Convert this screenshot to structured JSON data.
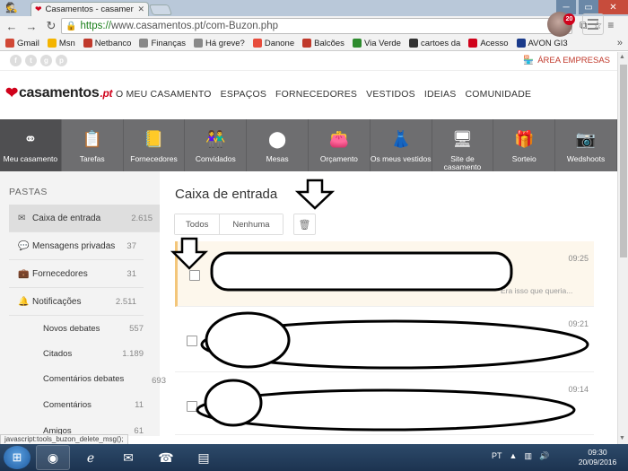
{
  "browser": {
    "tab_title": "Casamentos - casamentos",
    "url_scheme": "https://",
    "url_rest": "www.casamentos.pt/com-Buzon.php",
    "bookmarks": [
      {
        "label": "Gmail",
        "color": "#d14836"
      },
      {
        "label": "Msn",
        "color": "#f4b400"
      },
      {
        "label": "Netbanco",
        "color": "#c0392b"
      },
      {
        "label": "Finanças",
        "color": "#888888"
      },
      {
        "label": "Há greve?",
        "color": "#888888"
      },
      {
        "label": "Danone",
        "color": "#e74c3c"
      },
      {
        "label": "Balcões",
        "color": "#c0392b"
      },
      {
        "label": "Via Verde",
        "color": "#2e8b2e"
      },
      {
        "label": "cartoes da",
        "color": "#333333"
      },
      {
        "label": "Acesso",
        "color": "#d0021b"
      },
      {
        "label": "AVON GI3",
        "color": "#1a3a8a"
      }
    ]
  },
  "site": {
    "area_empresas": "ÁREA EMPRESAS",
    "logo_main": "casamentos",
    "logo_suffix": ".pt",
    "nav": [
      "O MEU CASAMENTO",
      "ESPAÇOS",
      "FORNECEDORES",
      "VESTIDOS",
      "IDEIAS",
      "COMUNIDADE"
    ],
    "avatar_badge": "20",
    "tools": [
      {
        "label": "Meu casamento",
        "icon": "rings-icon",
        "glyph": "⚭",
        "active": true
      },
      {
        "label": "Tarefas",
        "icon": "clipboard-icon",
        "glyph": "📋",
        "active": false
      },
      {
        "label": "Fornecedores",
        "icon": "notebook-icon",
        "glyph": "📒",
        "active": false
      },
      {
        "label": "Convidados",
        "icon": "guests-icon",
        "glyph": "👫",
        "active": false
      },
      {
        "label": "Mesas",
        "icon": "table-icon",
        "glyph": "⬤",
        "active": false
      },
      {
        "label": "Orçamento",
        "icon": "wallet-icon",
        "glyph": "👛",
        "active": false
      },
      {
        "label": "Os meus vestidos",
        "icon": "dress-icon",
        "glyph": "👗",
        "active": false
      },
      {
        "label": "Site de casamento",
        "icon": "website-icon",
        "glyph": "🖥",
        "active": false
      },
      {
        "label": "Sorteio",
        "icon": "gift-icon",
        "glyph": "🎁",
        "active": false
      },
      {
        "label": "Wedshoots",
        "icon": "camera-icon",
        "glyph": "📷",
        "active": false
      }
    ]
  },
  "sidebar": {
    "title": "PASTAS",
    "folders": [
      {
        "label": "Caixa de entrada",
        "count": "2.615",
        "icon": "inbox-icon",
        "glyph": "✉",
        "active": true
      },
      {
        "label": "Mensagens privadas",
        "count": "37",
        "icon": "chat-icon",
        "glyph": "💬",
        "active": false
      },
      {
        "label": "Fornecedores",
        "count": "31",
        "icon": "briefcase-icon",
        "glyph": "💼",
        "active": false
      },
      {
        "label": "Notificações",
        "count": "2.511",
        "icon": "bell-icon",
        "glyph": "🔔",
        "active": false
      }
    ],
    "subfolders": [
      {
        "label": "Novos debates",
        "count": "557"
      },
      {
        "label": "Citados",
        "count": "1.189"
      },
      {
        "label": "Comentários debates",
        "count": "693"
      },
      {
        "label": "Comentários",
        "count": "11"
      },
      {
        "label": "Amigos",
        "count": "61"
      }
    ]
  },
  "inbox": {
    "title": "Caixa de entrada",
    "btn_all": "Todos",
    "btn_none": "Nenhuma",
    "messages": [
      {
        "time": "09:25",
        "snippet": "Era isso que queria...",
        "unread": true
      },
      {
        "time": "09:21",
        "snippet": "",
        "unread": false
      },
      {
        "time": "09:14",
        "snippet": "",
        "unread": false
      }
    ]
  },
  "status_link": "javascript:tools_buzon_delete_msg();",
  "taskbar": {
    "language": "PT",
    "time": "09:30",
    "date": "20/09/2016"
  }
}
